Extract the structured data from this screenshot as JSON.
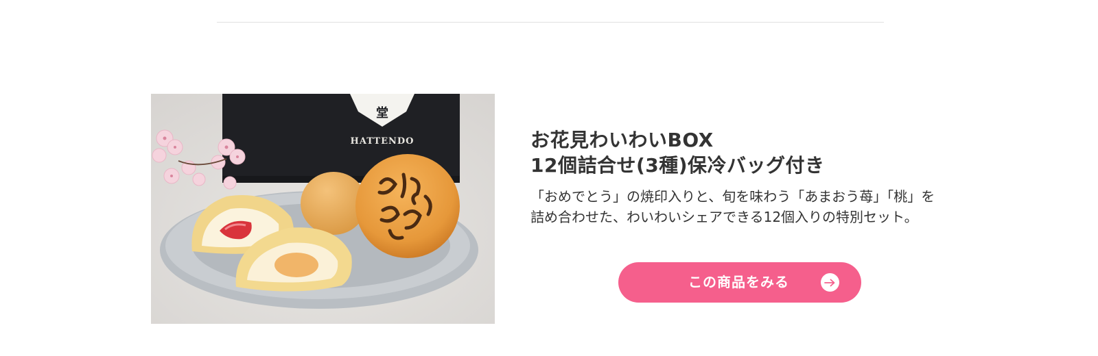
{
  "product": {
    "image_text": "HATTENDO",
    "title_line1": "お花見わいわいBOX",
    "title_line2": "12個詰合せ(3種)保冷バッグ付き",
    "description_line1": "「おめでとう」の焼印入りと、旬を味わう「あまおう苺」「桃」を",
    "description_line2": "詰め合わせた、わいわいシェアできる12個入りの特別セット。",
    "cta_label": "この商品をみる"
  },
  "colors": {
    "accent": "#f55f8c",
    "text": "#333333",
    "divider": "#e1e1e1"
  },
  "icons": {
    "cta": "arrow-right-circle-icon"
  }
}
